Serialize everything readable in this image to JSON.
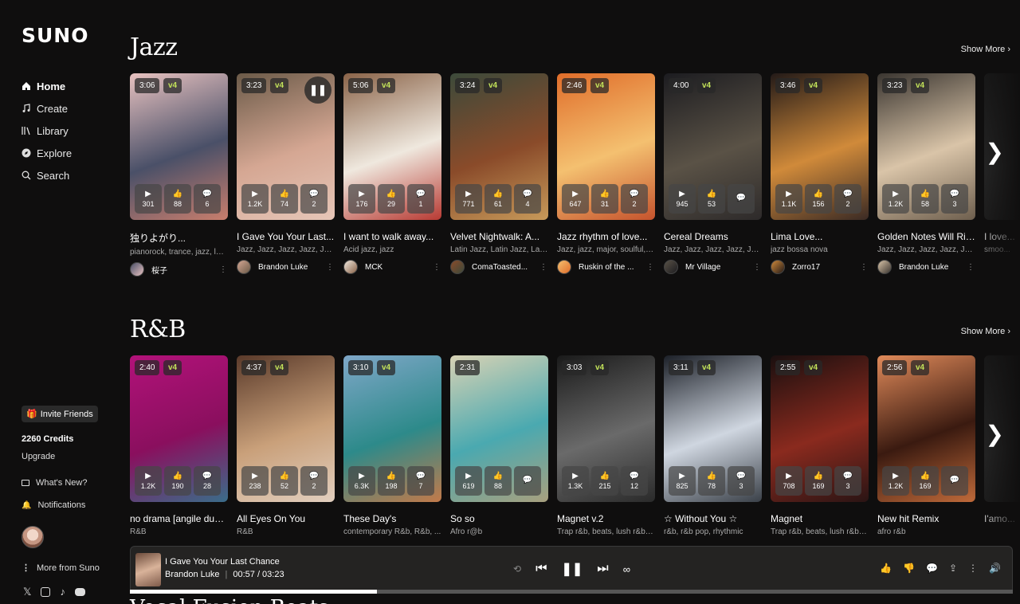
{
  "app": {
    "logo": "SUNO"
  },
  "sidebar": {
    "nav": [
      {
        "label": "Home",
        "icon": "home-icon",
        "active": true
      },
      {
        "label": "Create",
        "icon": "music-note-icon"
      },
      {
        "label": "Library",
        "icon": "library-icon"
      },
      {
        "label": "Explore",
        "icon": "compass-icon"
      },
      {
        "label": "Search",
        "icon": "search-icon"
      }
    ],
    "invite_label": "Invite Friends",
    "credits": "2260 Credits",
    "upgrade": "Upgrade",
    "whats_new": "What's New?",
    "notifications": "Notifications",
    "more_from": "More from Suno"
  },
  "sections": [
    {
      "title": "Jazz",
      "show_more": "Show More",
      "cards": [
        {
          "duration": "3:06",
          "version": "v4",
          "plays": "301",
          "likes": "88",
          "comments": "6",
          "title": "独りよがり...",
          "tags": "pianorock, trance, jazz, lat...",
          "user": "桜子",
          "colors": [
            "#e8c2c0",
            "#4a5068",
            "#c97e6d"
          ]
        },
        {
          "duration": "3:23",
          "version": "v4",
          "plays": "1.2K",
          "likes": "74",
          "comments": "2",
          "title": "I Gave You Your Last...",
          "tags": "Jazz, Jazz, Jazz, Jazz, Jazz...",
          "user": "Brandon Luke",
          "playing": true,
          "colors": [
            "#6b5a48",
            "#d5a793",
            "#e6c6b8"
          ]
        },
        {
          "duration": "5:06",
          "version": "v4",
          "plays": "176",
          "likes": "29",
          "comments": "1",
          "title": "I want to walk away...",
          "tags": "Acid jazz, jazz",
          "user": "MCK",
          "colors": [
            "#8a6348",
            "#efe8de",
            "#b83a33"
          ]
        },
        {
          "duration": "3:24",
          "version": "v4",
          "plays": "771",
          "likes": "61",
          "comments": "4",
          "title": "Velvet Nightwalk: A...",
          "tags": "Latin Jazz, Latin Jazz, Lati...",
          "user": "ComaToasted...",
          "colors": [
            "#3c4a3a",
            "#8a4b2a",
            "#c79a5a"
          ]
        },
        {
          "duration": "2:46",
          "version": "v4",
          "plays": "647",
          "likes": "31",
          "comments": "2",
          "title": "Jazz rhythm of love...",
          "tags": "Jazz, jazz, major, soulful, j...",
          "user": "Ruskin of the ...",
          "colors": [
            "#e06d2a",
            "#f4c070",
            "#c5532d"
          ]
        },
        {
          "duration": "4:00",
          "version": "v4",
          "plays": "945",
          "likes": "53",
          "comments": "",
          "title": "Cereal Dreams",
          "tags": "Jazz, Jazz, Jazz, Jazz, Jazz...",
          "user": "Mr Village",
          "colors": [
            "#1c1c20",
            "#5a5246",
            "#2d2a2a"
          ]
        },
        {
          "duration": "3:46",
          "version": "v4",
          "plays": "1.1K",
          "likes": "156",
          "comments": "2",
          "title": "Lima Love...",
          "tags": "jazz bossa nova",
          "user": "Zorro17",
          "colors": [
            "#231a18",
            "#d08a3a",
            "#3a2a24"
          ]
        },
        {
          "duration": "3:23",
          "version": "v4",
          "plays": "1.2K",
          "likes": "58",
          "comments": "3",
          "title": "Golden Notes Will Rise",
          "tags": "Jazz, Jazz, Jazz, Jazz, Jaz...",
          "user": "Brandon Luke",
          "colors": [
            "#3a3530",
            "#d9c4a8",
            "#6e5f4e"
          ]
        },
        {
          "duration": "",
          "version": "",
          "plays": "",
          "likes": "",
          "comments": "",
          "title": "I love...",
          "tags": "smoo...",
          "user": "",
          "colors": [
            "#1a1a1a",
            "#2a2a2a",
            "#1a1a1a"
          ]
        }
      ]
    },
    {
      "title": "R&B",
      "show_more": "Show More",
      "cards": [
        {
          "duration": "2:40",
          "version": "v4",
          "plays": "1.2K",
          "likes": "190",
          "comments": "28",
          "title": "no drama [angile dust...",
          "tags": "R&B",
          "user": "",
          "colors": [
            "#b2127a",
            "#8a0f5e",
            "#3a6d8a"
          ]
        },
        {
          "duration": "4:37",
          "version": "v4",
          "plays": "238",
          "likes": "52",
          "comments": "2",
          "title": "All Eyes On You",
          "tags": "R&B",
          "user": "",
          "colors": [
            "#5a3a2a",
            "#c9a07a",
            "#e2cfbf"
          ]
        },
        {
          "duration": "3:10",
          "version": "v4",
          "plays": "6.3K",
          "likes": "198",
          "comments": "7",
          "title": "These Day's",
          "tags": "contemporary R&b, R&b, ...",
          "user": "",
          "colors": [
            "#7fa7c8",
            "#2d8a8a",
            "#c27a4a"
          ]
        },
        {
          "duration": "2:31",
          "version": "",
          "plays": "619",
          "likes": "88",
          "comments": "",
          "title": "So so",
          "tags": "Afro r@b",
          "user": "",
          "colors": [
            "#d8d2b4",
            "#4aa9b0",
            "#a8a07e"
          ]
        },
        {
          "duration": "3:03",
          "version": "v4",
          "plays": "1.3K",
          "likes": "215",
          "comments": "12",
          "title": "Magnet v.2",
          "tags": "Trap r&b, beats, lush r&b, ...",
          "user": "",
          "colors": [
            "#1a1a1a",
            "#6a6a6a",
            "#2a2a2a"
          ]
        },
        {
          "duration": "3:11",
          "version": "v4",
          "plays": "825",
          "likes": "78",
          "comments": "3",
          "title": "☆ Without You ☆",
          "tags": "r&b, r&b pop, rhythmic",
          "user": "",
          "colors": [
            "#1c2028",
            "#cfd6e0",
            "#3a4048"
          ]
        },
        {
          "duration": "2:55",
          "version": "v4",
          "plays": "708",
          "likes": "169",
          "comments": "3",
          "title": "Magnet",
          "tags": "Trap r&b, beats, lush r&b, ...",
          "user": "",
          "colors": [
            "#1a0f0f",
            "#8a2a1e",
            "#2a1414"
          ]
        },
        {
          "duration": "2:56",
          "version": "v4",
          "plays": "1.2K",
          "likes": "169",
          "comments": "",
          "title": "New hit Remix",
          "tags": "afro r&b",
          "user": "",
          "colors": [
            "#e08a5a",
            "#3a1a10",
            "#c06a3a"
          ]
        },
        {
          "duration": "",
          "version": "",
          "plays": "",
          "likes": "",
          "comments": "",
          "title": "I'amo...",
          "tags": "",
          "user": "",
          "colors": [
            "#1a1a1a",
            "#2a2a2a",
            "#1a1a1a"
          ]
        }
      ]
    }
  ],
  "player": {
    "title": "I Gave You Your Last Chance",
    "artist": "Brandon Luke",
    "time": "00:57 / 03:23",
    "progress": 0.28
  },
  "next_section_title": "Vocal Fusion Beats",
  "colors": {
    "background": "#0f0e0e",
    "accent_version": "#c4e45a"
  }
}
